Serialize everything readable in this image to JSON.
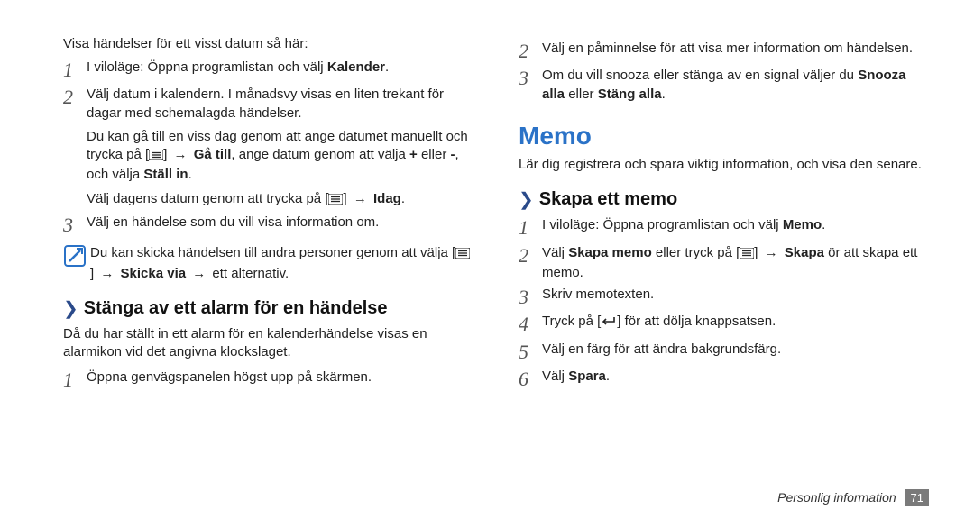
{
  "left": {
    "intro": "Visa händelser för ett visst datum så här:",
    "step1_pre": "I viloläge: Öppna programlistan och välj ",
    "step1_bold": "Kalender",
    "step1_post": ".",
    "step2_p1": "Välj datum i kalendern. I månadsvy visas en liten trekant för dagar med schemalagda händelser.",
    "step2_p2_a": "Du kan gå till en viss dag genom att ange datumet manuellt och trycka på [",
    "step2_p2_b": "] ",
    "arrow": "→",
    "step2_p2_c": " ",
    "step2_p2_bold1": "Gå till",
    "step2_p2_d": ", ange datum genom att välja ",
    "plus": "+",
    "step2_p2_e": " eller ",
    "minus": "-",
    "step2_p2_f": ", och välja ",
    "step2_p2_bold2": "Ställ in",
    "step2_p2_g": ".",
    "step2_p3_a": "Välj dagens datum genom att trycka på [",
    "step2_p3_b": "] ",
    "step2_p3_bold": "Idag",
    "step2_p3_c": ".",
    "step3": "Välj en händelse som du vill visa information om.",
    "note_a": "Du kan skicka händelsen till andra personer genom att välja [",
    "note_b": "] ",
    "note_bold": "Skicka via",
    "note_c": " ",
    "note_d": " ett alternativ.",
    "sub_title": "Stänga av ett alarm för en händelse",
    "sub_intro": "Då du har ställt in ett alarm för en kalenderhändelse visas en alarmikon vid det angivna klockslaget.",
    "sub_step1": "Öppna genvägspanelen högst upp på skärmen."
  },
  "right": {
    "step2": "Välj en påminnelse för att visa mer information om händelsen.",
    "step3_a": "Om du vill snooza eller stänga av en signal väljer du ",
    "step3_b1": "Snooza alla",
    "step3_mid": " eller ",
    "step3_b2": "Stäng alla",
    "step3_c": ".",
    "section": "Memo",
    "section_intro": "Lär dig registrera och spara viktig information, och visa den senare.",
    "sub_title": "Skapa ett memo",
    "s1_a": "I viloläge: Öppna programlistan och välj ",
    "s1_b": "Memo",
    "s1_c": ".",
    "s2_a": "Välj ",
    "s2_b": "Skapa memo",
    "s2_c": " eller tryck på [",
    "s2_d": "] ",
    "s2_e": " ",
    "s2_f": "Skapa",
    "s2_g": " ör att skapa ett memo.",
    "s3": "Skriv memotexten.",
    "s4_a": "Tryck på [",
    "s4_b": "] för att dölja knappsatsen.",
    "s5": "Välj en färg för att ändra bakgrundsfärg.",
    "s6_a": "Välj ",
    "s6_b": "Spara",
    "s6_c": "."
  },
  "footer_label": "Personlig information",
  "page_num": "71",
  "nums": {
    "n1": "1",
    "n2": "2",
    "n3": "3",
    "n4": "4",
    "n5": "5",
    "n6": "6"
  }
}
